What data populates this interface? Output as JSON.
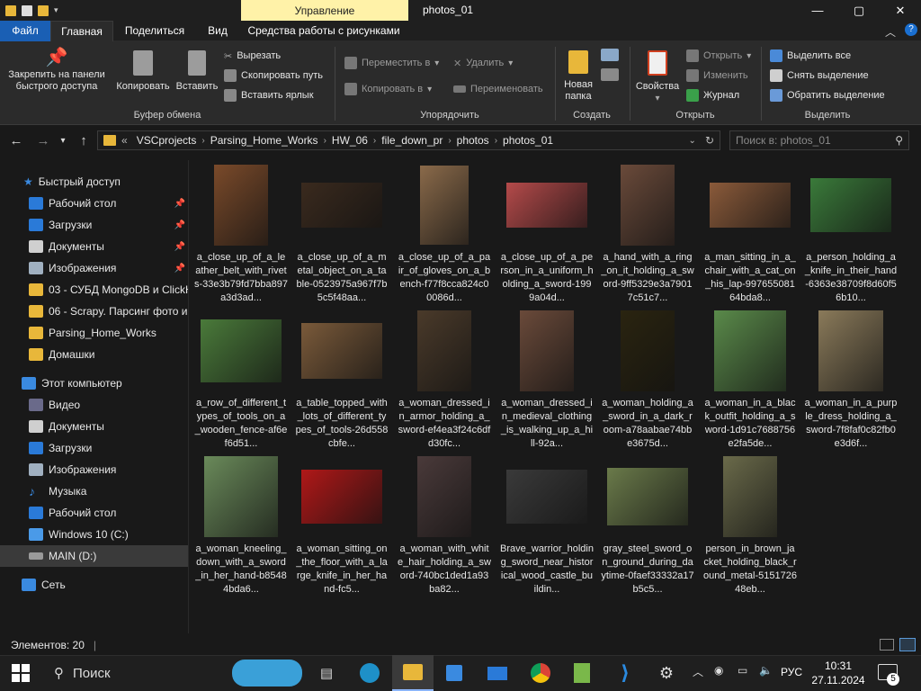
{
  "window": {
    "context_tab": "Управление",
    "title": "photos_01",
    "buttons": {
      "minimize": "—",
      "maximize": "▢",
      "close": "✕"
    }
  },
  "tabs": [
    "Файл",
    "Главная",
    "Поделиться",
    "Вид",
    "Средства работы с рисунками"
  ],
  "ribbon": {
    "clipboard": {
      "pin": "Закрепить на панели быстрого доступа",
      "copy": "Копировать",
      "paste": "Вставить",
      "cut": "Вырезать",
      "copy_path": "Скопировать путь",
      "paste_shortcut": "Вставить ярлык",
      "label": "Буфер обмена"
    },
    "organize": {
      "move_to": "Переместить в",
      "copy_to": "Копировать в",
      "delete": "Удалить",
      "rename": "Переименовать",
      "label": "Упорядочить"
    },
    "create": {
      "new_folder": "Новая папка",
      "label": "Создать"
    },
    "open": {
      "properties": "Свойства",
      "open": "Открыть",
      "edit": "Изменить",
      "history": "Журнал",
      "label": "Открыть"
    },
    "select": {
      "select_all": "Выделить все",
      "select_none": "Снять выделение",
      "invert": "Обратить выделение",
      "label": "Выделить"
    }
  },
  "address": {
    "crumbs": [
      "VSCprojects",
      "Parsing_Home_Works",
      "HW_06",
      "file_down_pr",
      "photos",
      "photos_01"
    ],
    "overflow": "«",
    "search_placeholder": "Поиск в: photos_01"
  },
  "nav": {
    "quick_access": "Быстрый доступ",
    "quick_items": [
      "Рабочий стол",
      "Загрузки",
      "Документы",
      "Изображения",
      "03 - СУБД MongoDB и ClickH",
      "06 - Scrapy. Парсинг фото и",
      "Parsing_Home_Works",
      "Домашки"
    ],
    "this_pc": "Этот компьютер",
    "pc_items": [
      "Видео",
      "Документы",
      "Загрузки",
      "Изображения",
      "Музыка",
      "Рабочий стол",
      "Windows 10 (C:)",
      "MAIN (D:)"
    ],
    "network": "Сеть"
  },
  "files": [
    {
      "name": "a_close_up_of_a_leather_belt_with_rivets-33e3b79fd7bba897a3d3ad...",
      "color": "#7a4a2a"
    },
    {
      "name": "a_close_up_of_a_metal_object_on_a_table-0523975a967f7b5c5f48aa...",
      "color": "#3a2a1e"
    },
    {
      "name": "a_close_up_of_a_pair_of_gloves_on_a_bench-f77f8cca824c00086d...",
      "color": "#8a6a4a"
    },
    {
      "name": "a_close_up_of_a_person_in_a_uniform_holding_a_sword-1999a04d...",
      "color": "#b44a4a"
    },
    {
      "name": "a_hand_with_a_ring_on_it_holding_a_sword-9ff5329e3a79017c51c7...",
      "color": "#6a4a3a"
    },
    {
      "name": "a_man_sitting_in_a_chair_with_a_cat_on_his_lap-99765508164bda8...",
      "color": "#8a5a3a"
    },
    {
      "name": "a_person_holding_a_knife_in_their_hand-6363e38709f8d60f56b10...",
      "color": "#3a7a3a"
    },
    {
      "name": "a_row_of_different_types_of_tools_on_a_wooden_fence-af6ef6d51...",
      "color": "#4a7a3a"
    },
    {
      "name": "a_table_topped_with_lots_of_different_types_of_tools-26d558cbfe...",
      "color": "#7a5a3a"
    },
    {
      "name": "a_woman_dressed_in_armor_holding_a_sword-ef4ea3f24c6dfd30fc...",
      "color": "#4a3a2a"
    },
    {
      "name": "a_woman_dressed_in_medieval_clothing_is_walking_up_a_hill-92a...",
      "color": "#6a4a3a"
    },
    {
      "name": "a_woman_holding_a_sword_in_a_dark_room-a78aabae74bbe3675d...",
      "color": "#2a2410"
    },
    {
      "name": "a_woman_in_a_black_outfit_holding_a_sword-1d91c7688756e2fa5de...",
      "color": "#5a8a4a"
    },
    {
      "name": "a_woman_in_a_purple_dress_holding_a_sword-7f8faf0c82fb0e3d6f...",
      "color": "#8a7a5a"
    },
    {
      "name": "a_woman_kneeling_down_with_a_sword_in_her_hand-b85484bda6...",
      "color": "#6a8a5a"
    },
    {
      "name": "a_woman_sitting_on_the_floor_with_a_large_knife_in_her_hand-fc5...",
      "color": "#b01818"
    },
    {
      "name": "a_woman_with_white_hair_holding_a_sword-740bc1ded1a93ba82...",
      "color": "#4a3a3a"
    },
    {
      "name": "Brave_warrior_holding_sword_near_historical_wood_castle_buildin...",
      "color": "#3a3a3a"
    },
    {
      "name": "gray_steel_sword_on_ground_during_daytime-0faef33332a17b5c5...",
      "color": "#6a7a4a"
    },
    {
      "name": "person_in_brown_jacket_holding_black_round_metal-515172648eb...",
      "color": "#6a6a4a"
    }
  ],
  "status": {
    "count": "Элементов: 20"
  },
  "taskbar": {
    "search": "Поиск",
    "lang": "РУС",
    "time": "10:31",
    "date": "27.11.2024",
    "notifications": "5"
  }
}
